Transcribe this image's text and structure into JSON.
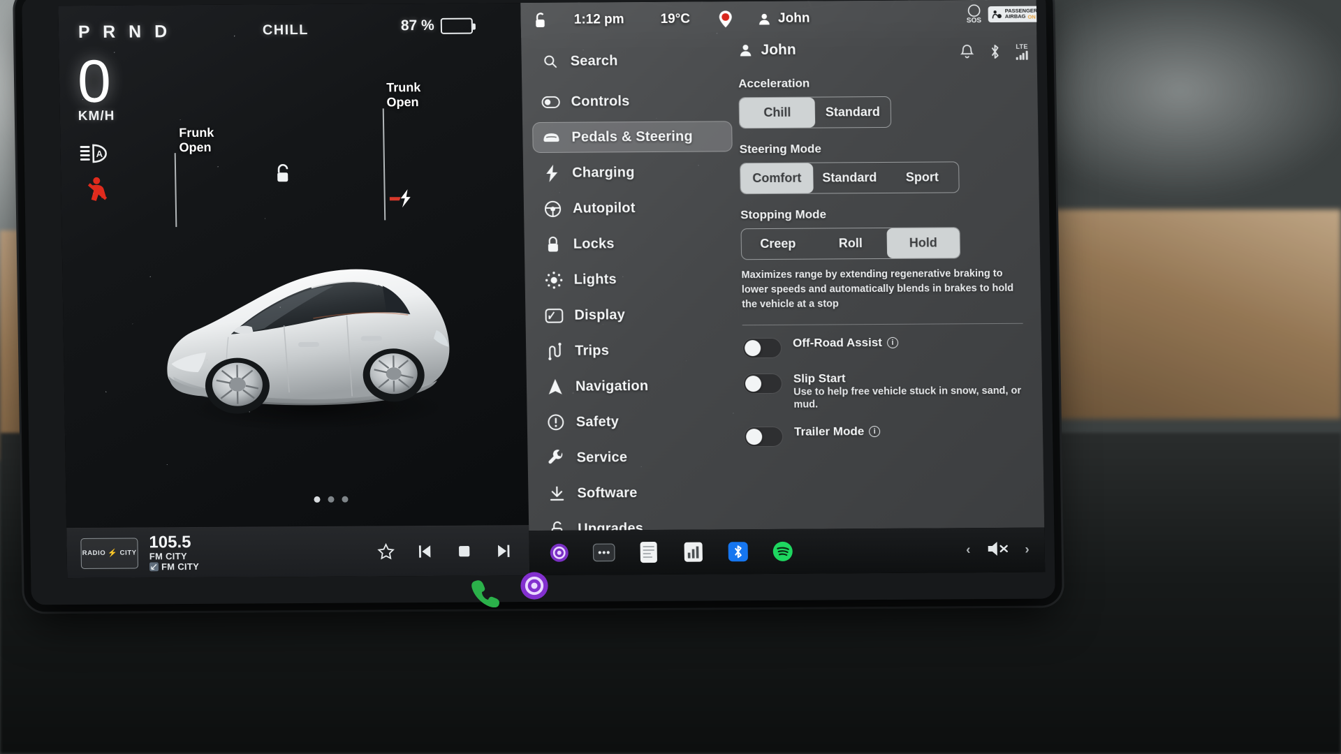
{
  "cluster": {
    "gear": "P R N D",
    "drive_mode": "CHILL",
    "battery_percent": "87 %",
    "battery_level": 87,
    "speed": "0",
    "speed_unit": "KM/H",
    "icons": {
      "auto_headlight": "auto-headlight-icon",
      "seatbelt_warning": "seatbelt-warning-icon"
    },
    "callouts": [
      {
        "id": "frunk",
        "line1": "Frunk",
        "line2": "Open"
      },
      {
        "id": "trunk",
        "line1": "Trunk",
        "line2": "Open"
      }
    ],
    "page_dots": {
      "count": 3,
      "active_index": 0
    }
  },
  "status_bar": {
    "lock_icon": "unlock-icon",
    "time": "1:12 pm",
    "temperature": "19°C",
    "location_icon": "location-pin-icon",
    "profile_icon": "person-icon",
    "profile_name": "John"
  },
  "corner_indicators": {
    "sos_label": "SOS",
    "airbag_line1": "PASSENGER",
    "airbag_line2": "AIRBAG",
    "airbag_status": "ON"
  },
  "right_icons": {
    "bell": "bell-icon",
    "bluetooth": "bluetooth-icon",
    "network_label": "LTE",
    "signal": "signal-bars-icon"
  },
  "menu": {
    "account_icon": "person-icon",
    "account_name": "John",
    "items": [
      {
        "label": "Search",
        "icon": "search-icon",
        "name": "search",
        "selected": false
      },
      {
        "label": "Controls",
        "icon": "toggle-icon",
        "name": "controls",
        "selected": false
      },
      {
        "label": "Pedals & Steering",
        "icon": "car-front-icon",
        "name": "pedals-steering",
        "selected": true
      },
      {
        "label": "Charging",
        "icon": "bolt-icon",
        "name": "charging",
        "selected": false
      },
      {
        "label": "Autopilot",
        "icon": "steering-icon",
        "name": "autopilot",
        "selected": false
      },
      {
        "label": "Locks",
        "icon": "lock-icon",
        "name": "locks",
        "selected": false
      },
      {
        "label": "Lights",
        "icon": "sun-icon",
        "name": "lights",
        "selected": false
      },
      {
        "label": "Display",
        "icon": "display-icon",
        "name": "display",
        "selected": false
      },
      {
        "label": "Trips",
        "icon": "route-icon",
        "name": "trips",
        "selected": false
      },
      {
        "label": "Navigation",
        "icon": "navigation-icon",
        "name": "navigation",
        "selected": false
      },
      {
        "label": "Safety",
        "icon": "warning-icon",
        "name": "safety",
        "selected": false
      },
      {
        "label": "Service",
        "icon": "wrench-icon",
        "name": "service",
        "selected": false
      },
      {
        "label": "Software",
        "icon": "download-icon",
        "name": "software",
        "selected": false
      },
      {
        "label": "Upgrades",
        "icon": "unlock-icon",
        "name": "upgrades",
        "selected": false
      }
    ]
  },
  "settings": {
    "acceleration": {
      "title": "Acceleration",
      "options": [
        "Chill",
        "Standard"
      ],
      "selected": "Chill"
    },
    "steering_mode": {
      "title": "Steering Mode",
      "options": [
        "Comfort",
        "Standard",
        "Sport"
      ],
      "selected": "Comfort"
    },
    "stopping_mode": {
      "title": "Stopping Mode",
      "options": [
        "Creep",
        "Roll",
        "Hold"
      ],
      "selected": "Hold",
      "description": "Maximizes range by extending regenerative braking to lower speeds and automatically blends in brakes to hold the vehicle at a stop"
    },
    "toggles": [
      {
        "label": "Off-Road Assist",
        "sub": "",
        "has_info": true,
        "on": false,
        "name": "off-road-assist"
      },
      {
        "label": "Slip Start",
        "sub": "Use to help free vehicle stuck in snow, sand, or mud.",
        "has_info": false,
        "on": false,
        "name": "slip-start"
      },
      {
        "label": "Trailer Mode",
        "sub": "",
        "has_info": true,
        "on": false,
        "name": "trailer-mode"
      }
    ]
  },
  "media": {
    "station_logo_left": "RADIO",
    "station_logo_right": "CITY",
    "frequency": "105.5",
    "line1": "FM CITY",
    "line2": "FM CITY",
    "controls": [
      "favorite-icon",
      "previous-icon",
      "stop-icon",
      "next-icon"
    ]
  },
  "dock": {
    "apps": [
      "phone-icon",
      "camera-icon",
      "more-icon",
      "calendar-icon",
      "charts-icon",
      "bluetooth-app-icon",
      "spotify-icon"
    ],
    "volume_icon": "volume-mute-icon",
    "prev_chevron": "‹",
    "next_chevron": "›"
  }
}
